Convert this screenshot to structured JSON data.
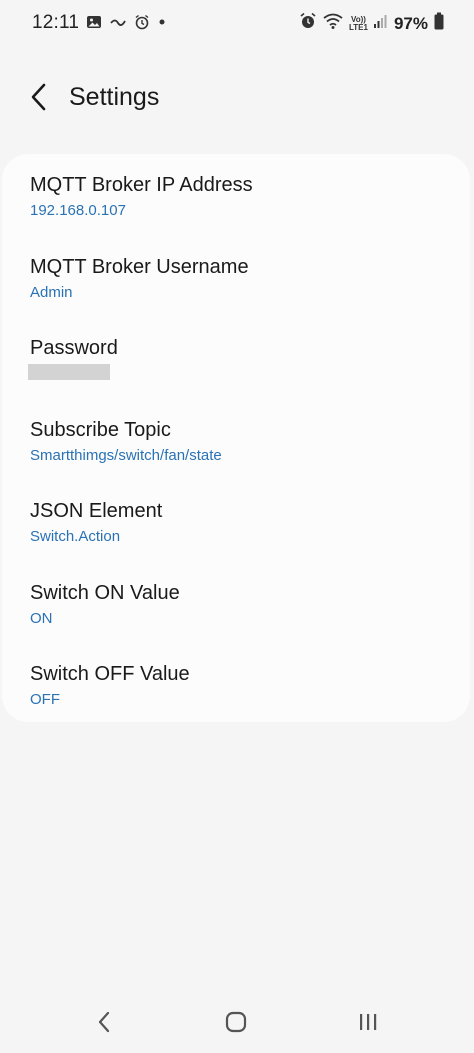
{
  "status_bar": {
    "time": "12:11",
    "battery_percent": "97%",
    "lte_top": "Vo))",
    "lte_bottom": "LTE1",
    "icons": [
      "gallery-icon",
      "squiggle-icon",
      "alarm-icon",
      "dot-icon",
      "alarm-clock-icon",
      "wifi-icon",
      "signal-icon",
      "battery-icon"
    ]
  },
  "header": {
    "title": "Settings",
    "back_icon": "chevron-left-icon"
  },
  "settings": {
    "items": [
      {
        "title": "MQTT Broker IP Address",
        "value": "192.168.0.107"
      },
      {
        "title": "MQTT Broker Username",
        "value": "Admin"
      },
      {
        "title": "Password",
        "value": ""
      },
      {
        "title": "Subscribe Topic",
        "value": "Smartthimgs/switch/fan/state"
      },
      {
        "title": "JSON Element",
        "value": "Switch.Action"
      },
      {
        "title": "Switch ON Value",
        "value": "ON"
      },
      {
        "title": "Switch OFF Value",
        "value": "OFF"
      }
    ]
  },
  "nav_bar": {
    "buttons": [
      "back-nav-icon",
      "home-nav-icon",
      "recents-nav-icon"
    ]
  },
  "colors": {
    "background": "#f5f5f5",
    "card": "#fcfcfc",
    "value_text": "#2a72b5",
    "title_text": "#1a1a1a"
  }
}
